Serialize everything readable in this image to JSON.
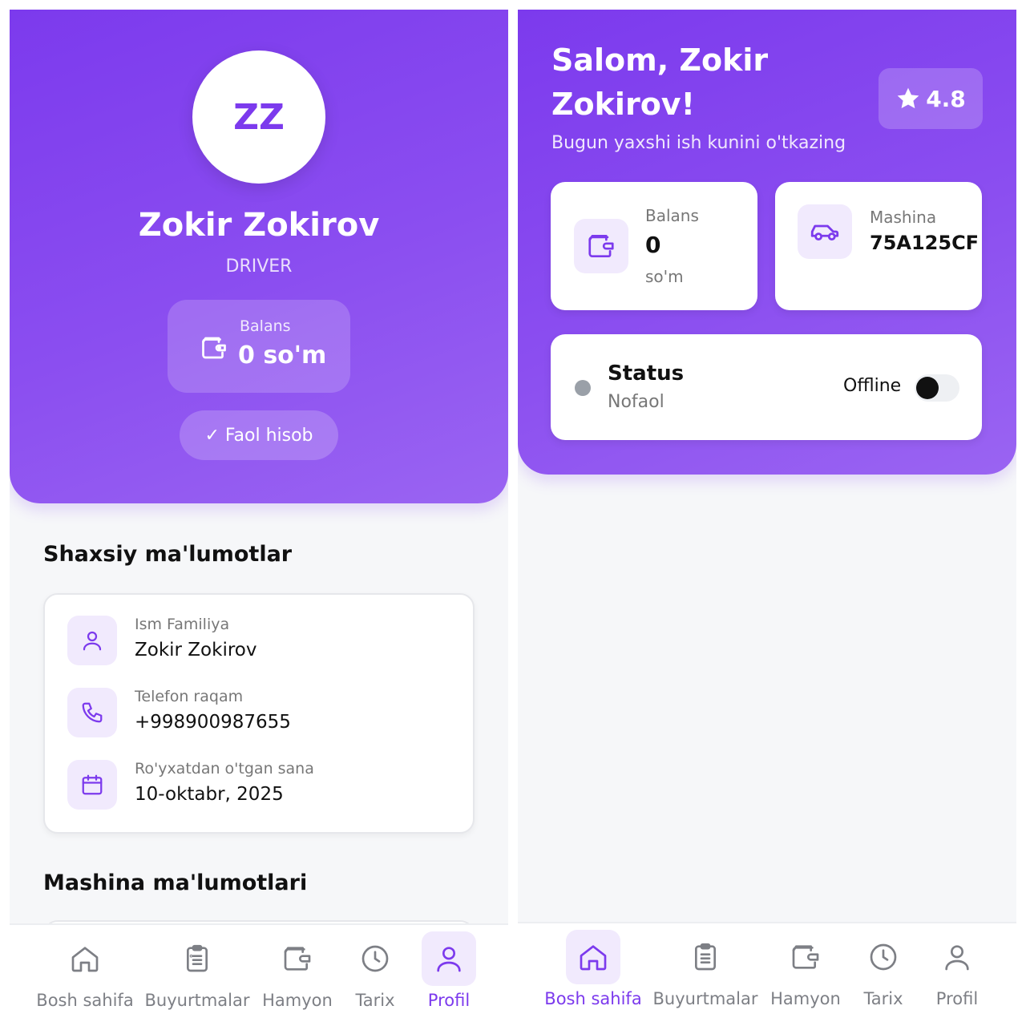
{
  "profile": {
    "initials": "ZZ",
    "name": "Zokir Zokirov",
    "role": "DRIVER",
    "balance_label": "Balans",
    "balance_value": "0 so'm",
    "account_status": "✓ Faol hisob",
    "personal_title": "Shaxsiy ma'lumotlar",
    "fields": [
      {
        "label": "Ism Familiya",
        "value": "Zokir Zokirov",
        "icon": "user-icon"
      },
      {
        "label": "Telefon raqam",
        "value": "+998900987655",
        "icon": "phone-icon"
      },
      {
        "label": "Ro'yxatdan o'tgan sana",
        "value": "10-oktabr, 2025",
        "icon": "calendar-icon"
      }
    ],
    "car_title": "Mashina ma'lumotlari"
  },
  "home": {
    "greeting": "Salom, Zokir Zokirov!",
    "subtitle": "Bugun yaxshi ish kunini o'tkazing",
    "rating": "4.8",
    "balance_label": "Balans",
    "balance_value": "0",
    "balance_unit": "so'm",
    "car_label": "Mashina",
    "car_value": "75A125CF",
    "status_title": "Status",
    "status_sub": "Nofaol",
    "status_toggle_label": "Offline",
    "status_online": false
  },
  "nav": {
    "items": [
      {
        "label": "Bosh sahifa",
        "icon": "home-icon"
      },
      {
        "label": "Buyurtmalar",
        "icon": "clipboard-icon"
      },
      {
        "label": "Hamyon",
        "icon": "wallet-icon"
      },
      {
        "label": "Tarix",
        "icon": "clock-icon"
      },
      {
        "label": "Profil",
        "icon": "user-icon"
      }
    ],
    "left_active": "Profil",
    "right_active": "Bosh sahifa"
  },
  "colors": {
    "accent": "#7c3aed",
    "accent_light": "#f1eafd",
    "status_offline": "#9aa0a8"
  }
}
